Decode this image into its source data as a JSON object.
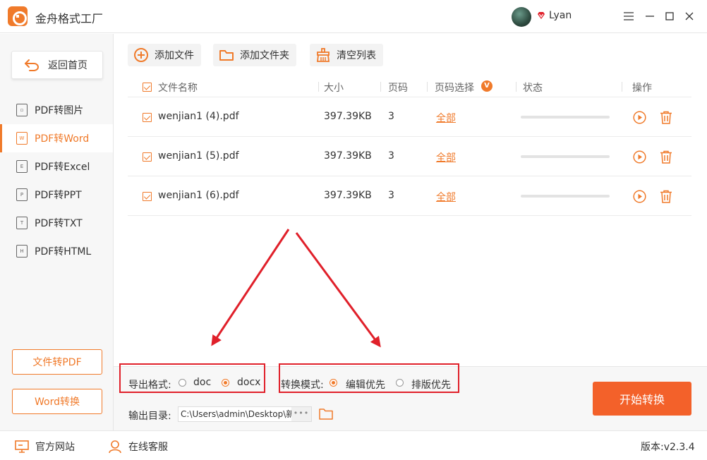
{
  "app": {
    "title": "金舟格式工厂",
    "user_name": "Lyan"
  },
  "sidebar": {
    "home_label": "返回首页",
    "items": [
      {
        "label": "PDF转图片",
        "icon": "image-file-icon"
      },
      {
        "label": "PDF转Word",
        "icon": "word-file-icon",
        "active": true
      },
      {
        "label": "PDF转Excel",
        "icon": "excel-file-icon"
      },
      {
        "label": "PDF转PPT",
        "icon": "ppt-file-icon"
      },
      {
        "label": "PDF转TXT",
        "icon": "txt-file-icon"
      },
      {
        "label": "PDF转HTML",
        "icon": "html-file-icon"
      }
    ],
    "file_to_pdf_label": "文件转PDF",
    "word_convert_label": "Word转换"
  },
  "toolbar": {
    "add_file_label": "添加文件",
    "add_folder_label": "添加文件夹",
    "clear_list_label": "清空列表"
  },
  "table": {
    "headers": {
      "name": "文件名称",
      "size": "大小",
      "pages": "页码",
      "page_select": "页码选择",
      "page_select_badge": "V",
      "status": "状态",
      "actions": "操作"
    },
    "rows": [
      {
        "name": "wenjian1 (4).pdf",
        "size": "397.39KB",
        "pages": "3",
        "page_select": "全部",
        "progress": 0
      },
      {
        "name": "wenjian1 (5).pdf",
        "size": "397.39KB",
        "pages": "3",
        "page_select": "全部",
        "progress": 0
      },
      {
        "name": "wenjian1 (6).pdf",
        "size": "397.39KB",
        "pages": "3",
        "page_select": "全部",
        "progress": 0
      }
    ]
  },
  "options": {
    "export_format_label": "导出格式:",
    "format_doc": "doc",
    "format_docx": "docx",
    "selected_format": "docx",
    "convert_mode_label": "转换模式:",
    "mode_edit": "编辑优先",
    "mode_layout": "排版优先",
    "selected_mode": "编辑优先",
    "output_dir_label": "输出目录:",
    "output_dir_value": "C:\\Users\\admin\\Desktop\\新",
    "more_label": "•••",
    "start_label": "开始转换"
  },
  "statusbar": {
    "website_label": "官方网站",
    "support_label": "在线客服",
    "version_label": "版本:",
    "version_value": "v2.3.4"
  },
  "colors": {
    "accent": "#f07a2a",
    "start_button": "#f3612a",
    "highlight_box": "#e0202a"
  }
}
